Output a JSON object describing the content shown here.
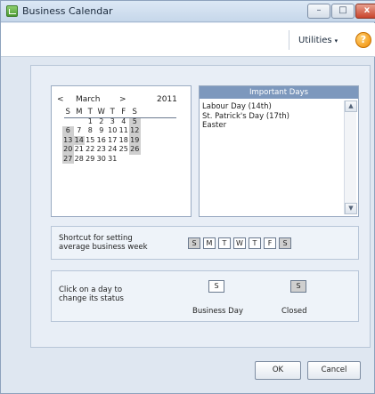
{
  "window": {
    "title": "Business Calendar"
  },
  "titlebar": {
    "minimize": "–",
    "maximize": "□",
    "close": "x"
  },
  "toolbar": {
    "utilities_label": "Utilities",
    "help_icon": "help-icon",
    "help_glyph": "?"
  },
  "calendar": {
    "prev": "<",
    "next": ">",
    "month": "March",
    "year": "2011",
    "weekday_headers": [
      "S",
      "M",
      "T",
      "W",
      "T",
      "F",
      "S"
    ],
    "weeks": [
      [
        "",
        "",
        "1",
        "2",
        "3",
        "4",
        "5"
      ],
      [
        "6",
        "7",
        "8",
        "9",
        "10",
        "11",
        "12"
      ],
      [
        "13",
        "14",
        "15",
        "16",
        "17",
        "18",
        "19"
      ],
      [
        "20",
        "21",
        "22",
        "23",
        "24",
        "25",
        "26"
      ],
      [
        "27",
        "28",
        "29",
        "30",
        "31",
        "",
        ""
      ]
    ]
  },
  "important_days": {
    "header": "Important Days",
    "items": [
      "Labour Day (14th)",
      "St. Patrick's Day (17th)",
      "Easter"
    ]
  },
  "shortcut": {
    "label": "Shortcut for setting average business week",
    "days": [
      "S",
      "M",
      "T",
      "W",
      "T",
      "F",
      "S"
    ]
  },
  "status": {
    "label": "Click on a day to change its status",
    "sample_letter": "S",
    "business_caption": "Business Day",
    "closed_caption": "Closed"
  },
  "buttons": {
    "ok": "OK",
    "cancel": "Cancel"
  },
  "colors": {
    "closed_gray": "#cfcfcf",
    "header_blue": "#7d98bd",
    "help_orange": "#f08a00"
  }
}
